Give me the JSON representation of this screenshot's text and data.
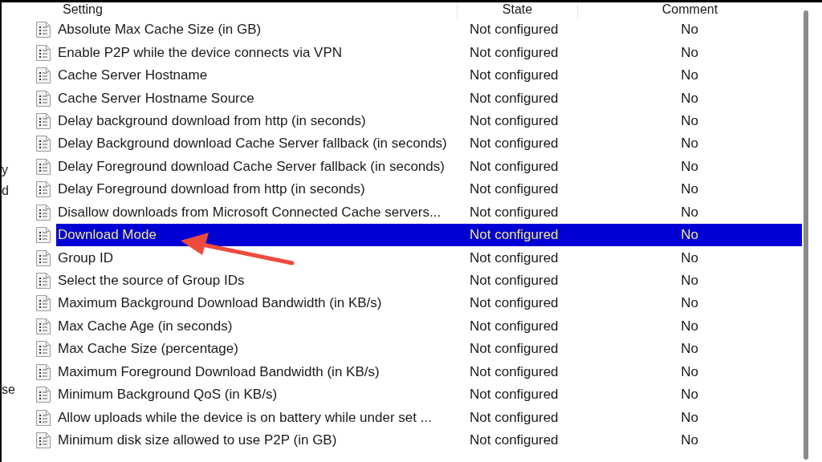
{
  "left_pane": {
    "fragments": [
      {
        "text": "y"
      },
      {
        "text": "d"
      },
      {
        "text": "se"
      }
    ]
  },
  "table": {
    "columns": [
      "Setting",
      "State",
      "Comment"
    ],
    "rows": [
      {
        "setting": "Absolute Max Cache Size (in GB)",
        "state": "Not configured",
        "comment": "No",
        "selected": false
      },
      {
        "setting": "Enable P2P while the device connects via VPN",
        "state": "Not configured",
        "comment": "No",
        "selected": false
      },
      {
        "setting": "Cache Server Hostname",
        "state": "Not configured",
        "comment": "No",
        "selected": false
      },
      {
        "setting": "Cache Server Hostname Source",
        "state": "Not configured",
        "comment": "No",
        "selected": false
      },
      {
        "setting": "Delay background download from http (in seconds)",
        "state": "Not configured",
        "comment": "No",
        "selected": false
      },
      {
        "setting": "Delay Background download Cache Server fallback (in seconds)",
        "state": "Not configured",
        "comment": "No",
        "selected": false
      },
      {
        "setting": "Delay Foreground download Cache Server fallback (in seconds)",
        "state": "Not configured",
        "comment": "No",
        "selected": false
      },
      {
        "setting": "Delay Foreground download from http (in seconds)",
        "state": "Not configured",
        "comment": "No",
        "selected": false
      },
      {
        "setting": "Disallow downloads from Microsoft Connected Cache servers...",
        "state": "Not configured",
        "comment": "No",
        "selected": false
      },
      {
        "setting": "Download Mode",
        "state": "Not configured",
        "comment": "No",
        "selected": true
      },
      {
        "setting": "Group ID",
        "state": "Not configured",
        "comment": "No",
        "selected": false
      },
      {
        "setting": "Select the source of Group IDs",
        "state": "Not configured",
        "comment": "No",
        "selected": false
      },
      {
        "setting": "Maximum Background Download Bandwidth (in KB/s)",
        "state": "Not configured",
        "comment": "No",
        "selected": false
      },
      {
        "setting": "Max Cache Age (in seconds)",
        "state": "Not configured",
        "comment": "No",
        "selected": false
      },
      {
        "setting": "Max Cache Size (percentage)",
        "state": "Not configured",
        "comment": "No",
        "selected": false
      },
      {
        "setting": "Maximum Foreground Download Bandwidth (in KB/s)",
        "state": "Not configured",
        "comment": "No",
        "selected": false
      },
      {
        "setting": "Minimum Background QoS (in KB/s)",
        "state": "Not configured",
        "comment": "No",
        "selected": false
      },
      {
        "setting": "Allow uploads while the device is on battery while under set ...",
        "state": "Not configured",
        "comment": "No",
        "selected": false
      },
      {
        "setting": "Minimum disk size allowed to use P2P (in GB)",
        "state": "Not configured",
        "comment": "No",
        "selected": false
      }
    ]
  }
}
